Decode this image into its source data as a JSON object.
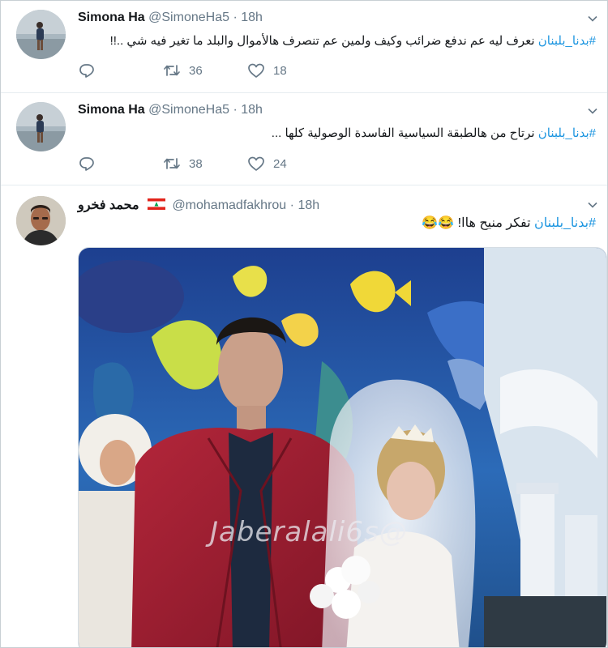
{
  "tweets": [
    {
      "name": "Simona Ha",
      "handle": "@SimoneHa5",
      "separator": "·",
      "time": "18h",
      "hashtag": "#بدنا_بلبنان",
      "body": " نعرف ليه عم ندفع ضرائب وكيف ولمين عم تنصرف هالأموال والبلد ما تغير فيه شي ..!!",
      "replies": "",
      "retweets": "36",
      "likes": "18"
    },
    {
      "name": "Simona Ha",
      "handle": "@SimoneHa5",
      "separator": "·",
      "time": "18h",
      "hashtag": "#بدنا_بلبنان",
      "body": " نرتاح من هالطبقة السياسية الفاسدة الوصولية كلها ...",
      "replies": "",
      "retweets": "38",
      "likes": "24"
    },
    {
      "name": "محمد فخرو",
      "handle": "@mohamadfakhrou",
      "separator": "·",
      "time": "18h",
      "hashtag": "#بدنا_بلبنان",
      "body": " تفكر منيح هاا! 😂😂",
      "media_watermark": "Jaberalali6s@"
    }
  ],
  "icons": {
    "reply": "reply-icon",
    "retweet": "retweet-icon",
    "like": "heart-icon",
    "caret": "chevron-down-icon",
    "flag": "lebanon-flag-icon"
  },
  "colors": {
    "hashtag": "#1b95e0",
    "muted": "#657786",
    "divider": "#e6ecf0"
  }
}
